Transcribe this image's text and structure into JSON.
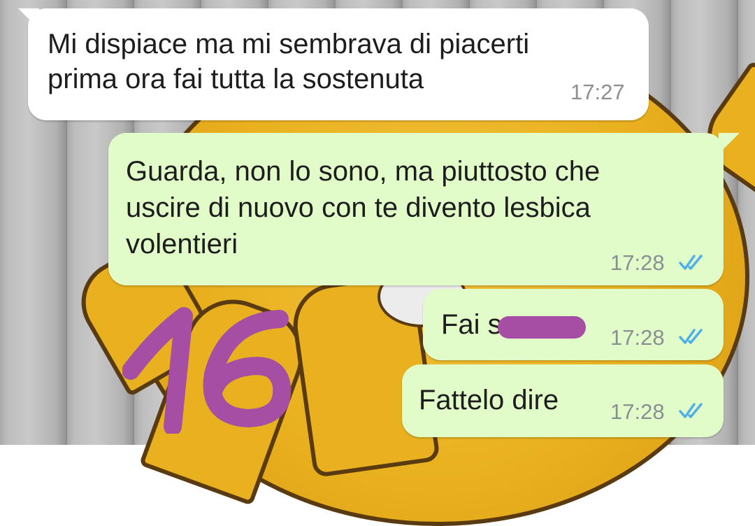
{
  "chat": {
    "messages": [
      {
        "direction": "incoming",
        "lines": [
          "Mi dispiace ma mi sembrava di piacerti",
          "prima ora fai tutta la sostenuta"
        ],
        "time": "17:27"
      },
      {
        "direction": "outgoing",
        "lines": [
          "Guarda, non lo sono, ma piuttosto che",
          "uscire di nuovo con te divento lesbica",
          "volentieri"
        ],
        "time": "17:28",
        "status": "read-ticks-icon"
      },
      {
        "direction": "outgoing",
        "text": "Fai s",
        "redacted": true,
        "time": "17:28",
        "status": "read-ticks-icon"
      },
      {
        "direction": "outgoing",
        "text": "Fattelo dire",
        "time": "17:28",
        "status": "read-ticks-icon"
      }
    ]
  },
  "annotation": {
    "handwritten_number": "16",
    "color": "#a64ea3"
  },
  "colors": {
    "incoming_bubble": "#ffffff",
    "outgoing_bubble": "#e2fcc9",
    "timestamp": "#8a8f94",
    "read_ticks": "#4fb0e6",
    "wallpaper_sun": "#e9b11f"
  }
}
